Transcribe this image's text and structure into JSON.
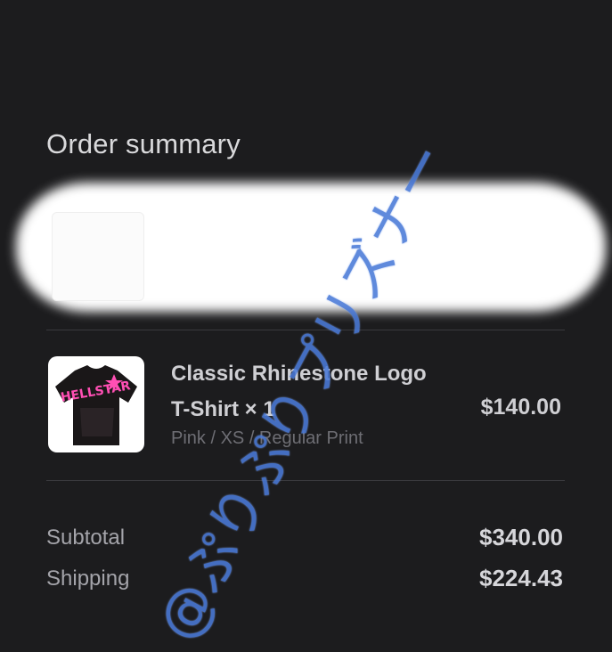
{
  "order_summary": {
    "title": "Order summary"
  },
  "item": {
    "name": "Classic Rhinestone Logo T-Shirt × 1",
    "variant": "Pink / XS / Regular Print",
    "price": "$140.00",
    "thumbnail_text": "HELLSTAR",
    "thumbnail_colors": {
      "shirt": "#1a1718",
      "print": "#ff4fb4"
    }
  },
  "totals": {
    "subtotal_label": "Subtotal",
    "subtotal_value": "$340.00",
    "shipping_label": "Shipping",
    "shipping_value": "$224.43"
  },
  "watermark": "@ぷりぷりプリズナー",
  "colors": {
    "background": "#1c1c1e",
    "watermark": "#4a7ad8"
  }
}
